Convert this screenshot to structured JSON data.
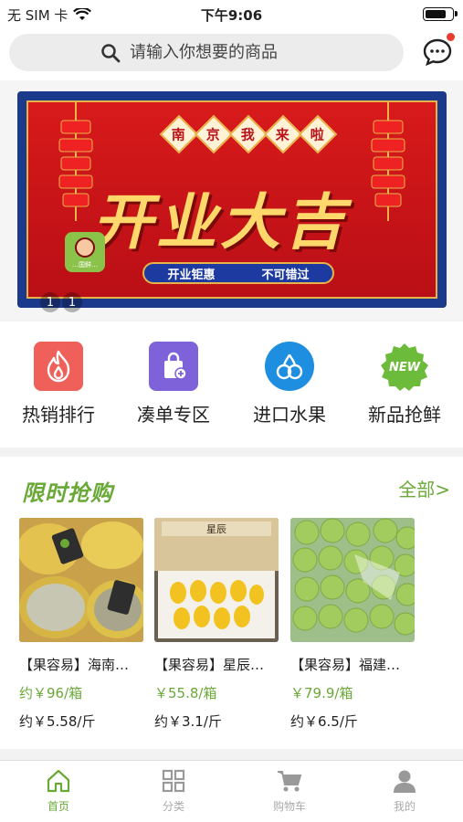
{
  "status_bar": {
    "carrier": "无 SIM 卡",
    "time": "下午9:06",
    "battery_level": 0.85
  },
  "search": {
    "placeholder": "请输入你想要的商品",
    "icon": "search-icon"
  },
  "messages": {
    "icon": "chat-bubble-icon",
    "has_unread": true
  },
  "banner": {
    "subtitle_chars": [
      "南",
      "京",
      "我",
      "来",
      "啦"
    ],
    "title": "开业大吉",
    "tag_left": "开业钜惠",
    "tag_right": "不可错过",
    "logo_text": "…国鲜…",
    "pager": [
      "1",
      "1"
    ]
  },
  "quick_nav": [
    {
      "label": "热销排行",
      "icon": "flame-icon",
      "color": "#f0605a"
    },
    {
      "label": "凑单专区",
      "icon": "shopping-bag-icon",
      "color": "#7d62d9"
    },
    {
      "label": "进口水果",
      "icon": "cherry-icon",
      "color": "#1e8fe0"
    },
    {
      "label": "新品抢鲜",
      "icon": "new-badge-icon",
      "color": "#6dbb3a",
      "badge": "NEW"
    }
  ],
  "flash_sale": {
    "title": "限时抢购",
    "more_label": "全部>",
    "products": [
      {
        "name": "【果容易】海南…",
        "price": "约￥96/箱",
        "unit_price": "约￥5.58/斤",
        "image": "melon-box"
      },
      {
        "name": "【果容易】星辰…",
        "price": "￥55.8/箱",
        "unit_price": "约￥3.1/斤",
        "image": "yellow-fruit-box",
        "box_text": "星辰"
      },
      {
        "name": "【果容易】福建…",
        "price": "￥79.9/箱",
        "unit_price": "约￥6.5/斤",
        "image": "green-fruit-bag"
      }
    ]
  },
  "tabbar": [
    {
      "label": "首页",
      "icon": "home-icon",
      "active": true
    },
    {
      "label": "分类",
      "icon": "grid-icon",
      "active": false
    },
    {
      "label": "购物车",
      "icon": "cart-icon",
      "active": false
    },
    {
      "label": "我的",
      "icon": "person-icon",
      "active": false
    }
  ],
  "colors": {
    "accent": "#6aa837",
    "alert": "#e53c2e",
    "banner_red": "#d81a1a",
    "banner_blue": "#1c3a8c"
  }
}
